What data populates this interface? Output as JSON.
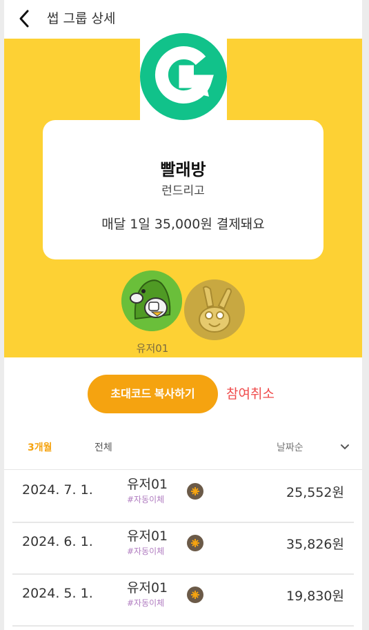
{
  "header": {
    "title": "썹 그룹 상세"
  },
  "group": {
    "name": "빨래방",
    "brand": "런드리고",
    "payment_text": "매달 1일 35,000원 결제돼요",
    "logo_letter": "G",
    "brand_color": "#11c28a",
    "hero_color": "#fdd134"
  },
  "members": [
    {
      "name": "유저01"
    }
  ],
  "actions": {
    "invite_label": "초대코드 복사하기",
    "cancel_label": "참여취소",
    "accent": "#f5a310",
    "cancel_color": "#ef4b4b"
  },
  "filters": {
    "tab_3m": "3개월",
    "tab_all": "전체",
    "sort_label": "날짜순"
  },
  "payments": [
    {
      "date": "2024. 7. 1.",
      "user": "유저01",
      "tag": "#자동이체",
      "amount": "25,552원"
    },
    {
      "date": "2024. 6. 1.",
      "user": "유저01",
      "tag": "#자동이체",
      "amount": "35,826원"
    },
    {
      "date": "2024. 5. 1.",
      "user": "유저01",
      "tag": "#자동이체",
      "amount": "19,830원"
    }
  ]
}
